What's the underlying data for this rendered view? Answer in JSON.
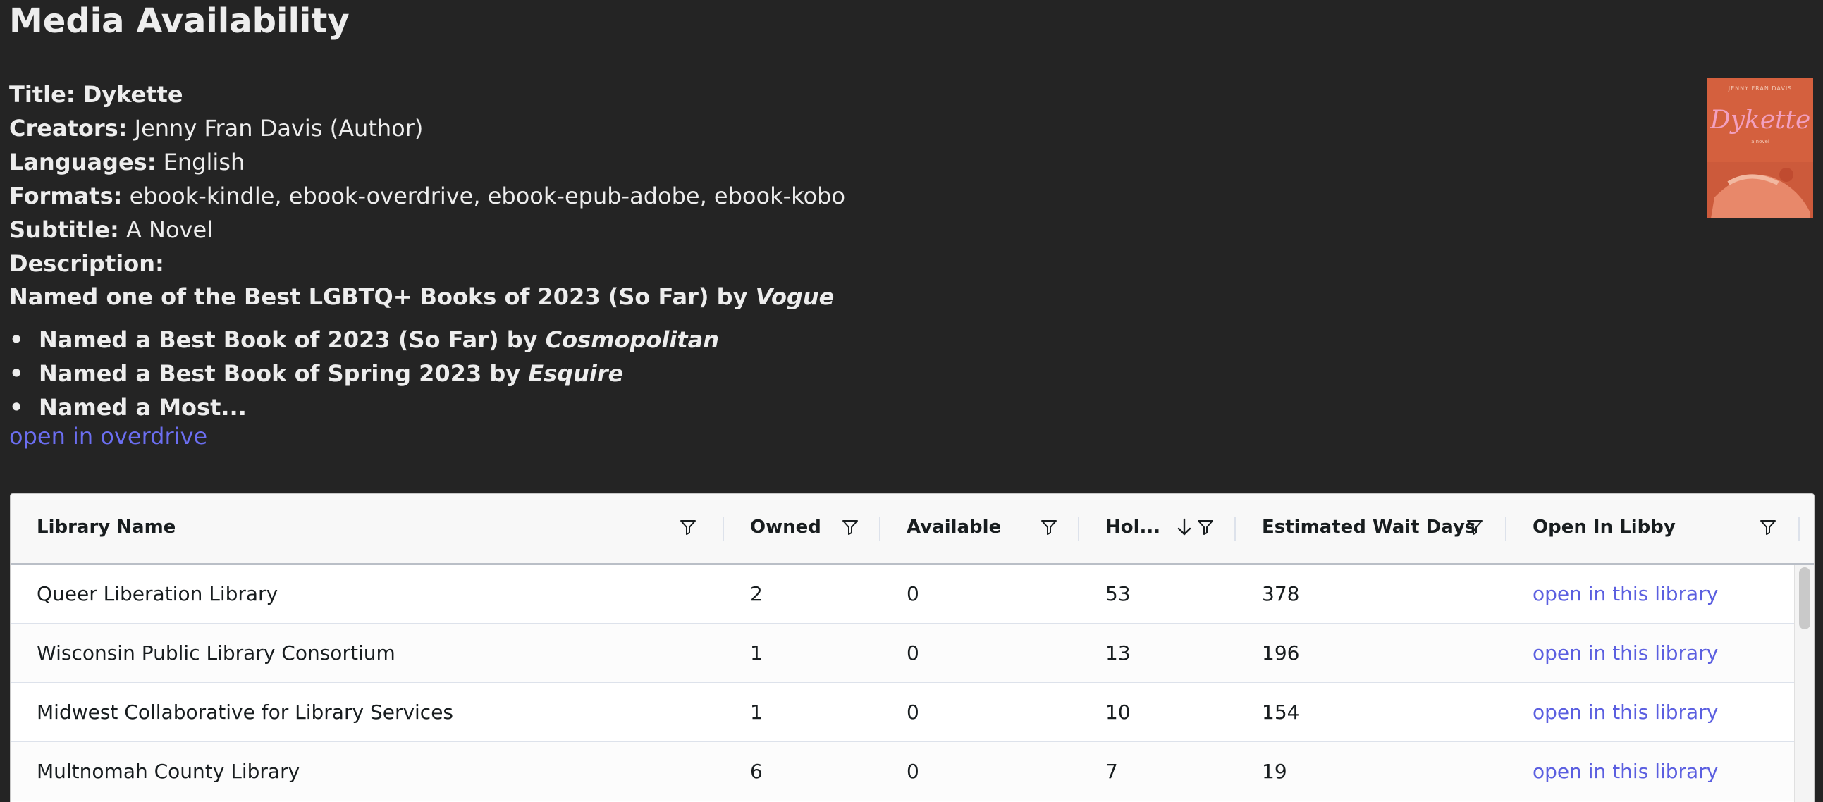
{
  "page": {
    "heading": "Media Availability"
  },
  "metadata": {
    "title_label": "Title:",
    "title_value": "Dykette",
    "creators_label": "Creators:",
    "creators_value": "Jenny Fran Davis (Author)",
    "languages_label": "Languages:",
    "languages_value": "English",
    "formats_label": "Formats:",
    "formats_value": "ebook-kindle, ebook-overdrive, ebook-epub-adobe, ebook-kobo",
    "subtitle_label": "Subtitle:",
    "subtitle_value": "A Novel",
    "description_label": "Description:"
  },
  "description": {
    "lead_text": "Named one of the Best LGBTQ+ Books of 2023 (So Far) by ",
    "lead_em": "Vogue",
    "bullets": [
      {
        "text": "Named a Best Book of 2023 (So Far) by ",
        "em": "Cosmopolitan"
      },
      {
        "text": "Named a Best Book of Spring 2023 by ",
        "em": "Esquire"
      },
      {
        "text": "Named a Most...",
        "em": ""
      }
    ],
    "bullet_glyph": "•"
  },
  "overdrive_link": "open in overdrive",
  "cover": {
    "author": "JENNY FRAN DAVIS",
    "title": "Dykette",
    "subtitle": "a novel"
  },
  "table": {
    "columns": [
      {
        "label": "Library Name"
      },
      {
        "label": "Owned"
      },
      {
        "label": "Available"
      },
      {
        "label": "Hol..."
      },
      {
        "label": "Estimated Wait Days"
      },
      {
        "label": "Open In Libby"
      }
    ],
    "sorted_column": "Hol...",
    "sort_direction": "descending",
    "rows": [
      {
        "library": "Queer Liberation Library",
        "owned": "2",
        "available": "0",
        "holds": "53",
        "wait": "378",
        "link": "open in this library"
      },
      {
        "library": "Wisconsin Public Library Consortium",
        "owned": "1",
        "available": "0",
        "holds": "13",
        "wait": "196",
        "link": "open in this library"
      },
      {
        "library": "Midwest Collaborative for Library Services",
        "owned": "1",
        "available": "0",
        "holds": "10",
        "wait": "154",
        "link": "open in this library"
      },
      {
        "library": "Multnomah County Library",
        "owned": "6",
        "available": "0",
        "holds": "7",
        "wait": "19",
        "link": "open in this library"
      }
    ]
  },
  "colors": {
    "background": "#242424",
    "link": "#6b6ef0",
    "table_link": "#5b5fe0",
    "cover": "#d5603f"
  },
  "icons": {
    "filter": "filter-icon",
    "sort": "arrow-down-icon"
  }
}
